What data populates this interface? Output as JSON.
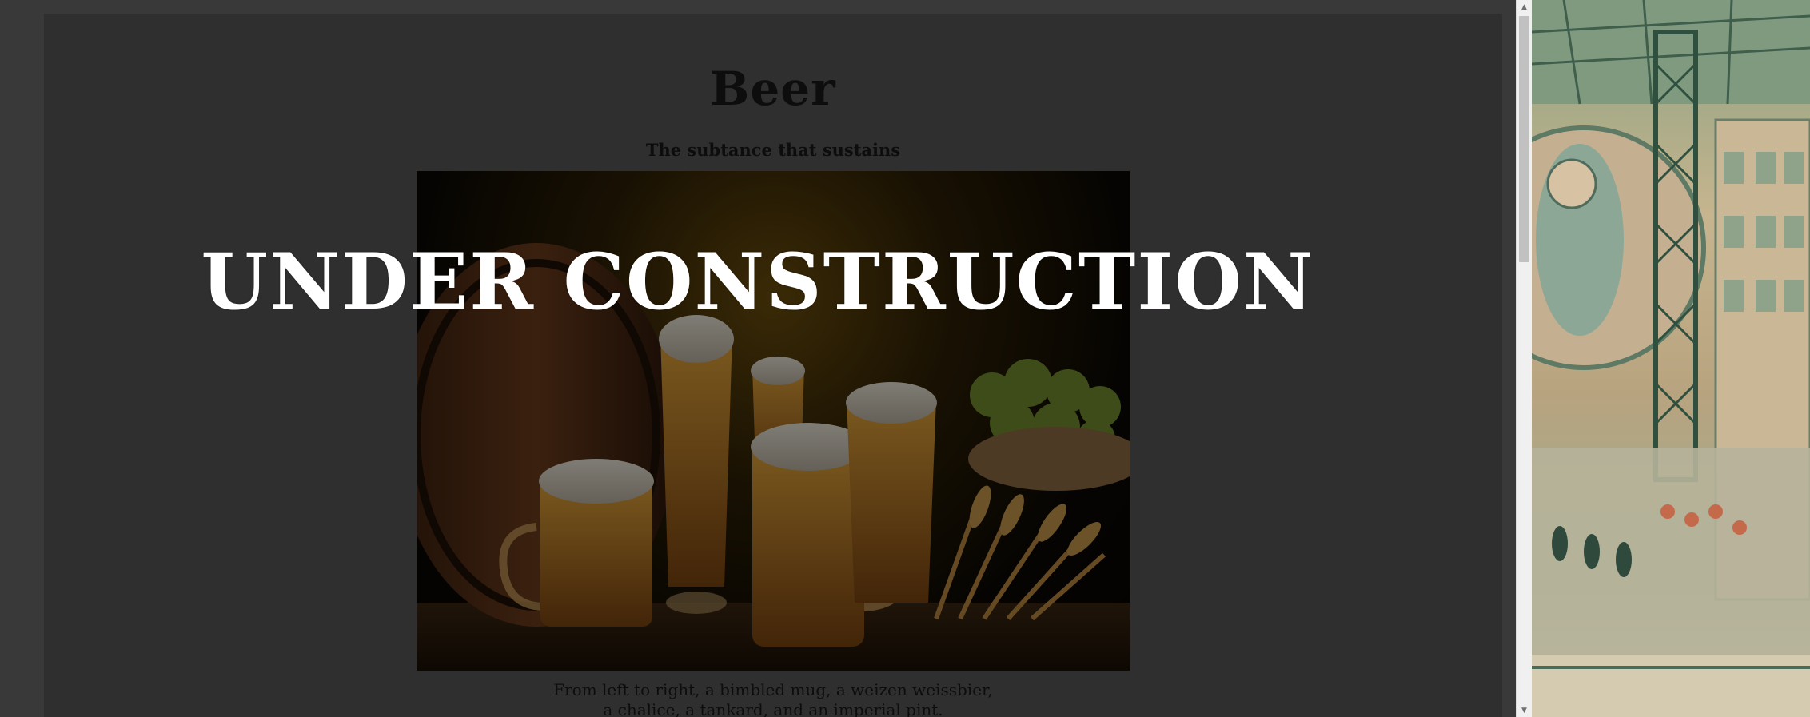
{
  "page": {
    "title": "Beer",
    "subtitle": "The subtance that sustains",
    "overlay_text": "UNDER CONSTRUCTION",
    "caption_line1": "From left to right, a bimbled mug, a weizen weissbier,",
    "caption_line2": "a chalice, a tankard, and an imperial pint."
  },
  "hero_image": {
    "subject": "beer glasses with barrel, hops and wheat",
    "alt": "Beer glasses"
  },
  "scrollbar": {
    "up_icon": "triangle-up",
    "down_icon": "triangle-down"
  },
  "side_art": {
    "subject": "illustrated fantasy cityscape with tower"
  },
  "colors": {
    "page_background": "#3a393a",
    "card_background": "#302f30",
    "text": "#0e0d0e",
    "overlay_text": "#ffffff",
    "beer_amber": "#c8871e"
  }
}
